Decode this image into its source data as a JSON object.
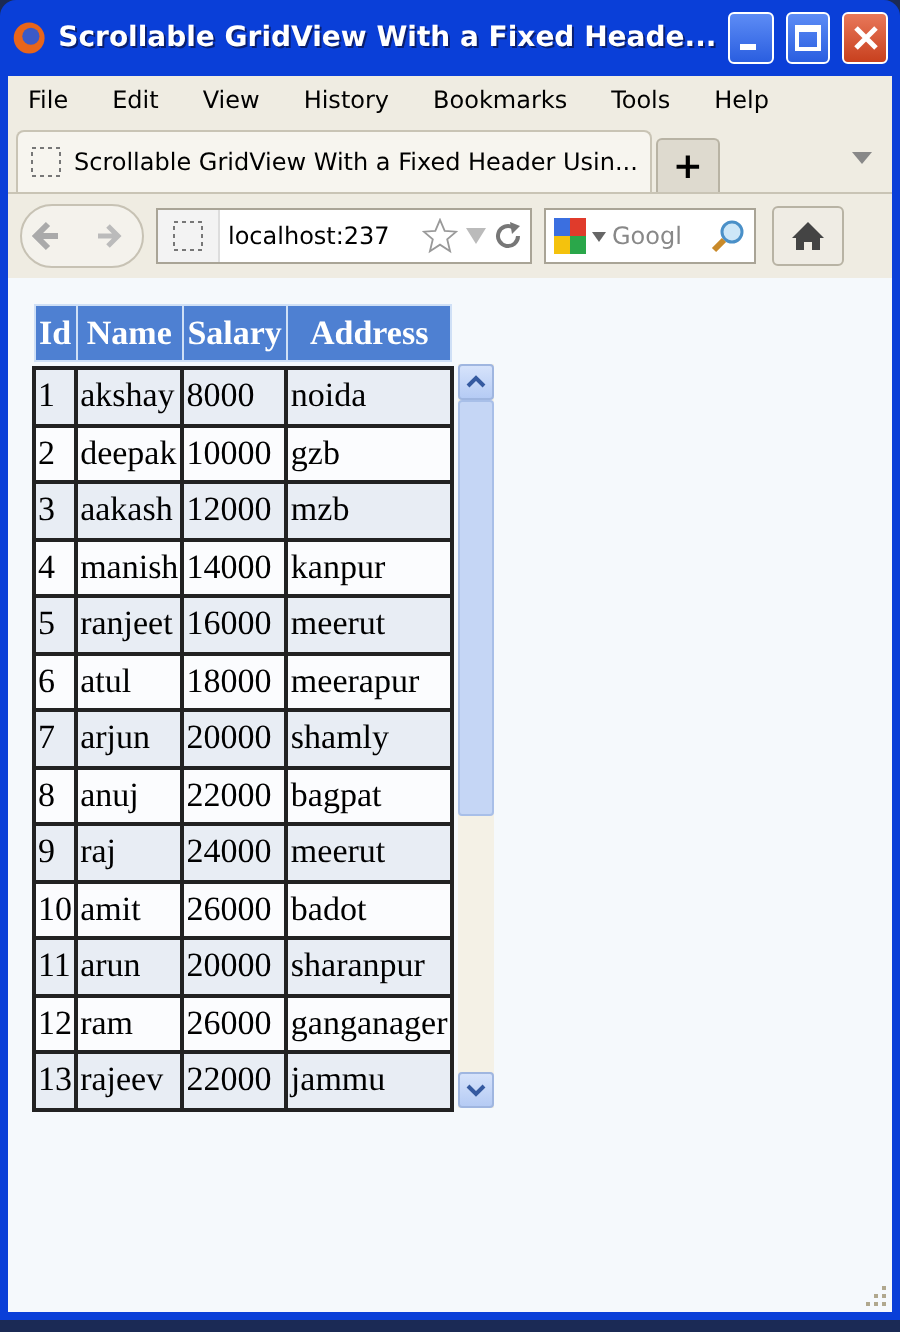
{
  "window": {
    "title": "Scrollable GridView With a Fixed Heade..."
  },
  "menu": [
    "File",
    "Edit",
    "View",
    "History",
    "Bookmarks",
    "Tools",
    "Help"
  ],
  "tabs": [
    {
      "label": "Scrollable GridView With a Fixed Header Usin...",
      "selected": true
    }
  ],
  "new_tab": "+",
  "address_bar": {
    "value": "localhost:237"
  },
  "search": {
    "placeholder": "Googl"
  },
  "table": {
    "columns": [
      "Id",
      "Name",
      "Salary",
      "Address"
    ],
    "rows": [
      [
        "1",
        "akshay",
        "8000",
        "noida"
      ],
      [
        "2",
        "deepak",
        "10000",
        "gzb"
      ],
      [
        "3",
        "aakash",
        "12000",
        "mzb"
      ],
      [
        "4",
        "manish",
        "14000",
        "kanpur"
      ],
      [
        "5",
        "ranjeet",
        "16000",
        "meerut"
      ],
      [
        "6",
        "atul",
        "18000",
        "meerapur"
      ],
      [
        "7",
        "arjun",
        "20000",
        "shamly"
      ],
      [
        "8",
        "anuj",
        "22000",
        "bagpat"
      ],
      [
        "9",
        "raj",
        "24000",
        "meerut"
      ],
      [
        "10",
        "amit",
        "26000",
        "badot"
      ],
      [
        "11",
        "arun",
        "20000",
        "sharanpur"
      ],
      [
        "12",
        "ram",
        "26000",
        "ganganager"
      ],
      [
        "13",
        "rajeev",
        "22000",
        "jammu"
      ]
    ]
  }
}
